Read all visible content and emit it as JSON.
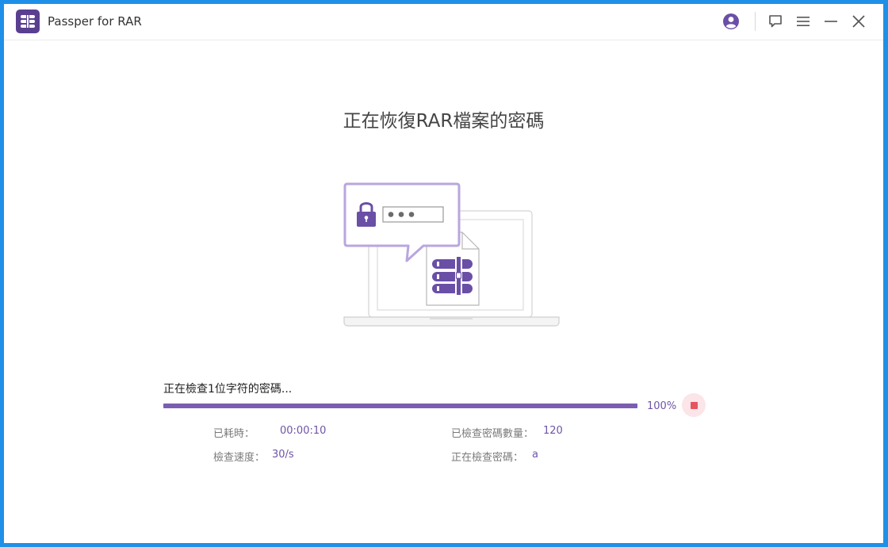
{
  "app": {
    "title": "Passper for RAR",
    "logo_icon": "rar-archive-icon"
  },
  "titlebar_icons": [
    "account-icon",
    "feedback-icon",
    "menu-icon",
    "minimize-icon",
    "close-icon"
  ],
  "main": {
    "heading": "正在恢復RAR檔案的密碼",
    "status": "正在檢查1位字符的密碼...",
    "progress_fraction": 1.0,
    "progress_label": "100%"
  },
  "stats": {
    "elapsed_label": "已耗時：",
    "elapsed_value": "00:00:10",
    "checked_count_label": "已檢查密碼數量：",
    "checked_count_value": "120",
    "speed_label": "檢查速度：",
    "speed_value": "30/s",
    "current_password_label": "正在檢查密碼：",
    "current_password_value": "a"
  },
  "colors": {
    "accent": "#7b5eb1",
    "brand": "#5a3f91",
    "stop": "#e5545f",
    "desktop": "#1e90e8"
  }
}
